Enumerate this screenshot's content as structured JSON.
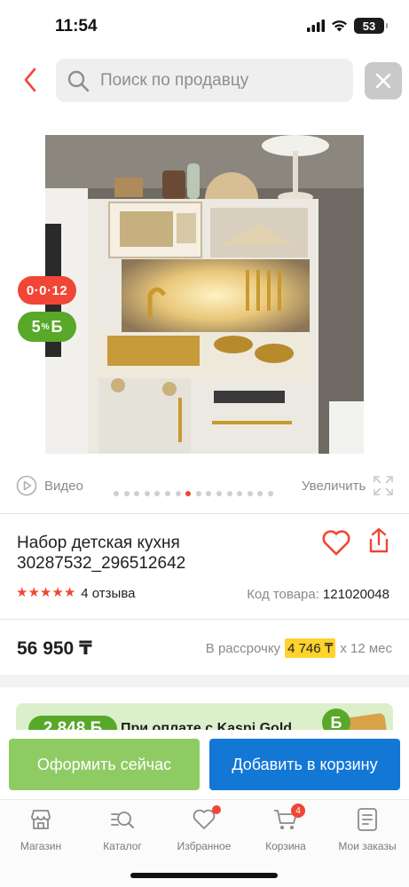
{
  "status_bar": {
    "time": "11:54",
    "battery": "53"
  },
  "search": {
    "placeholder": "Поиск по продавцу",
    "value": ""
  },
  "badges": {
    "installment": "0·0·12",
    "bonus_percent": "5",
    "bonus_unit": "%",
    "bonus_currency": "Б"
  },
  "gallery": {
    "video_label": "Видео",
    "zoom_label": "Увеличить",
    "dot_count": 16,
    "active_dot": 7
  },
  "product": {
    "title_line1": "Набор детская кухня",
    "title_line2": "30287532_296512642",
    "rating_stars": 5,
    "reviews": "4 отзыва",
    "code_label": "Код товара:",
    "code_value": "121020048",
    "price": "56 950 ₸",
    "installment_prefix": "В рассрочку",
    "installment_amount": "4 746 ₸",
    "installment_suffix": "х 12 мес"
  },
  "promo": {
    "bonus": "2 848 Б",
    "text": "При оплате с Kaspi Gold",
    "badge": "Б"
  },
  "actions": {
    "buy_now": "Оформить сейчас",
    "add_to_cart": "Добавить в корзину"
  },
  "tabs": [
    {
      "label": "Магазин",
      "icon": "store-icon"
    },
    {
      "label": "Каталог",
      "icon": "catalog-search-icon"
    },
    {
      "label": "Избранное",
      "icon": "heart-icon"
    },
    {
      "label": "Корзина",
      "icon": "cart-icon",
      "badge": "4"
    },
    {
      "label": "Мои заказы",
      "icon": "orders-icon"
    }
  ],
  "colors": {
    "accent_red": "#f14635",
    "bonus_green": "#58a82a",
    "buy_green": "#8fcb63",
    "cart_blue": "#1377d6",
    "installment_yellow": "#ffd22e"
  }
}
